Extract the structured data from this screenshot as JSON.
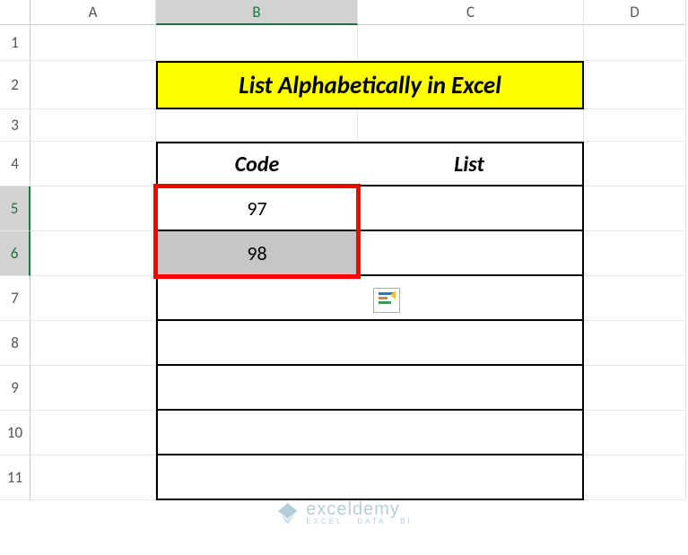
{
  "columns": {
    "A": "A",
    "B": "B",
    "C": "C",
    "D": "D"
  },
  "rows": {
    "1": "1",
    "2": "2",
    "3": "3",
    "4": "4",
    "5": "5",
    "6": "6",
    "7": "7",
    "8": "8",
    "9": "9",
    "10": "10",
    "11": "11"
  },
  "title": "List Alphabetically in Excel",
  "headers": {
    "code": "Code",
    "list": "List"
  },
  "values": {
    "b5": "97",
    "b6": "98"
  },
  "watermark": {
    "main": "exceldemy",
    "sub": "EXCEL · DATA · BI"
  },
  "chart_data": {
    "type": "table",
    "title": "List Alphabetically in Excel",
    "columns": [
      "Code",
      "List"
    ],
    "rows": [
      {
        "Code": 97,
        "List": ""
      },
      {
        "Code": 98,
        "List": ""
      },
      {
        "Code": "",
        "List": ""
      },
      {
        "Code": "",
        "List": ""
      },
      {
        "Code": "",
        "List": ""
      },
      {
        "Code": "",
        "List": ""
      },
      {
        "Code": "",
        "List": ""
      }
    ]
  }
}
